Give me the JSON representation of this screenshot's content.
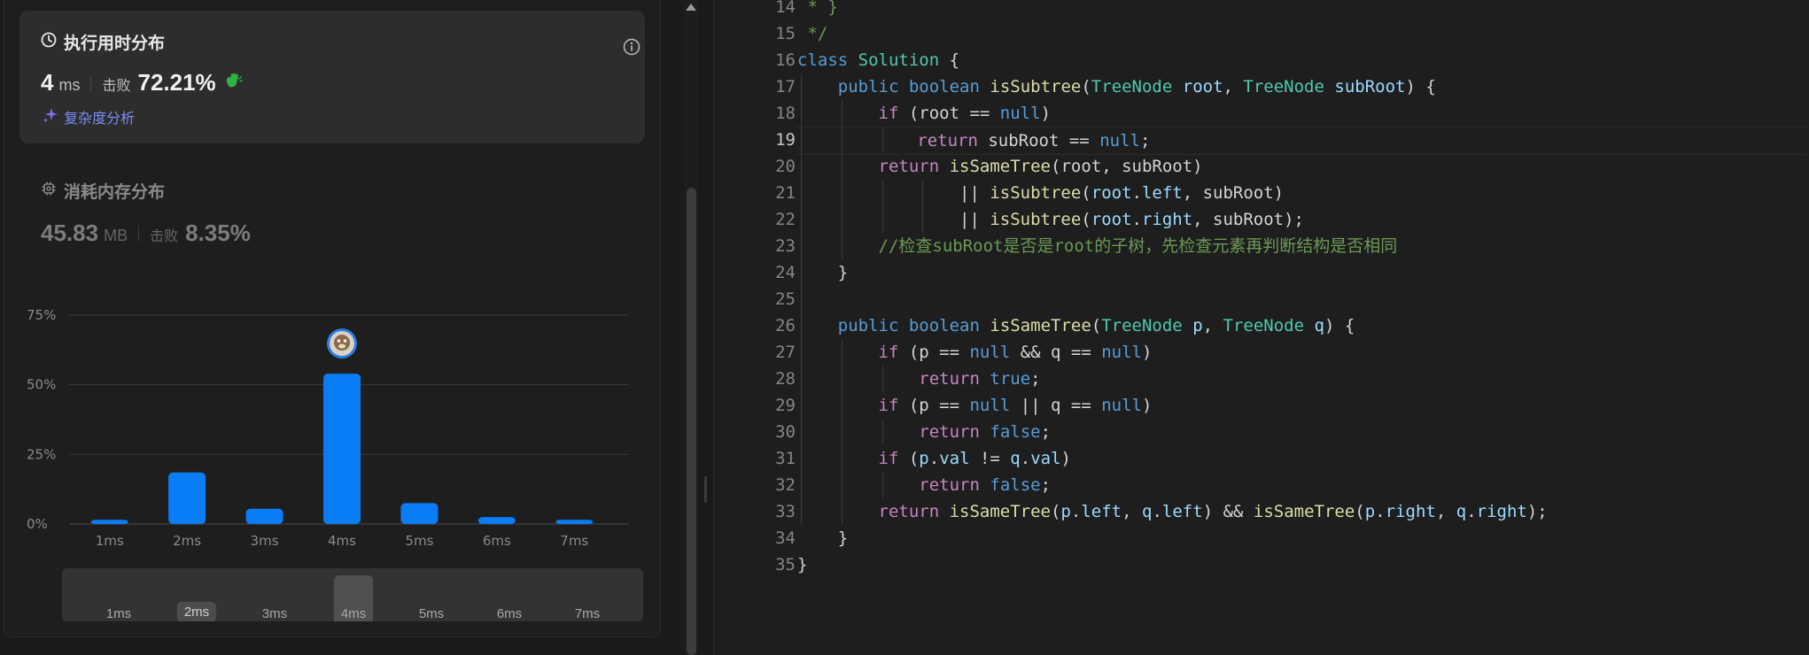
{
  "runtime": {
    "title": "执行用时分布",
    "value": "4",
    "unit": "ms",
    "beat_label": "击败",
    "beat_percent": "72.21%",
    "complexity_link": "复杂度分析"
  },
  "memory": {
    "title": "消耗内存分布",
    "value": "45.83",
    "unit": "MB",
    "beat_label": "击败",
    "beat_percent": "8.35%"
  },
  "chart_data": {
    "type": "bar",
    "categories": [
      "1ms",
      "2ms",
      "3ms",
      "4ms",
      "5ms",
      "6ms",
      "7ms"
    ],
    "values": [
      1.5,
      18.5,
      5.5,
      54,
      7.5,
      2.5,
      1.5
    ],
    "ylim": [
      0,
      75
    ],
    "yticks": [
      "0%",
      "25%",
      "50%",
      "75%"
    ],
    "ytick_values": [
      0,
      25,
      50,
      75
    ],
    "highlight_category": "4ms",
    "bar_color": "#0a7cf5",
    "grid": true
  },
  "range_slider": {
    "labels": [
      "1ms",
      "2ms",
      "3ms",
      "4ms",
      "5ms",
      "6ms",
      "7ms"
    ],
    "selected_pill": "2ms",
    "highlighted": "4ms"
  },
  "editor": {
    "line_numbers": [
      "14",
      "15",
      "16",
      "17",
      "18",
      "19",
      "20",
      "21",
      "22",
      "23",
      "24",
      "25",
      "26",
      "27",
      "28",
      "29",
      "30",
      "31",
      "32",
      "33",
      "34",
      "35"
    ],
    "active_line": "19",
    "lines": [
      [
        [
          "cm",
          " * }"
        ]
      ],
      [
        [
          "cm",
          " */"
        ]
      ],
      [
        [
          "kw",
          "class"
        ],
        [
          "pun",
          " "
        ],
        [
          "ty",
          "Solution"
        ],
        [
          "pun",
          " {"
        ]
      ],
      [
        [
          "pun",
          "    "
        ],
        [
          "kw",
          "public"
        ],
        [
          "pun",
          " "
        ],
        [
          "kw",
          "boolean"
        ],
        [
          "pun",
          " "
        ],
        [
          "fn",
          "isSubtree"
        ],
        [
          "pun",
          "("
        ],
        [
          "ty",
          "TreeNode"
        ],
        [
          "pun",
          " "
        ],
        [
          "var",
          "root"
        ],
        [
          "pun",
          ", "
        ],
        [
          "ty",
          "TreeNode"
        ],
        [
          "pun",
          " "
        ],
        [
          "var",
          "subRoot"
        ],
        [
          "pun",
          ") {"
        ]
      ],
      [
        [
          "pun",
          "        "
        ],
        [
          "ctl",
          "if"
        ],
        [
          "pun",
          " (root == "
        ],
        [
          "kw",
          "null"
        ],
        [
          "pun",
          ")"
        ]
      ],
      [
        [
          "pun",
          "            "
        ],
        [
          "ctl",
          "return"
        ],
        [
          "pun",
          " subRoot == "
        ],
        [
          "kw",
          "null"
        ],
        [
          "pun",
          ";"
        ]
      ],
      [
        [
          "pun",
          "        "
        ],
        [
          "ctl",
          "return"
        ],
        [
          "pun",
          " "
        ],
        [
          "fn",
          "isSameTree"
        ],
        [
          "pun",
          "(root, subRoot)"
        ]
      ],
      [
        [
          "pun",
          "                || "
        ],
        [
          "fn",
          "isSubtree"
        ],
        [
          "pun",
          "("
        ],
        [
          "var",
          "root"
        ],
        [
          "pun",
          "."
        ],
        [
          "var",
          "left"
        ],
        [
          "pun",
          ", subRoot)"
        ]
      ],
      [
        [
          "pun",
          "                || "
        ],
        [
          "fn",
          "isSubtree"
        ],
        [
          "pun",
          "("
        ],
        [
          "var",
          "root"
        ],
        [
          "pun",
          "."
        ],
        [
          "var",
          "right"
        ],
        [
          "pun",
          ", subRoot);"
        ]
      ],
      [
        [
          "pun",
          "        "
        ],
        [
          "cm",
          "//检查subRoot是否是root的子树，先检查元素再判断结构是否相同"
        ]
      ],
      [
        [
          "pun",
          "    }"
        ]
      ],
      [
        [
          "pun",
          ""
        ]
      ],
      [
        [
          "pun",
          "    "
        ],
        [
          "kw",
          "public"
        ],
        [
          "pun",
          " "
        ],
        [
          "kw",
          "boolean"
        ],
        [
          "pun",
          " "
        ],
        [
          "fn",
          "isSameTree"
        ],
        [
          "pun",
          "("
        ],
        [
          "ty",
          "TreeNode"
        ],
        [
          "pun",
          " "
        ],
        [
          "var",
          "p"
        ],
        [
          "pun",
          ", "
        ],
        [
          "ty",
          "TreeNode"
        ],
        [
          "pun",
          " "
        ],
        [
          "var",
          "q"
        ],
        [
          "pun",
          ") {"
        ]
      ],
      [
        [
          "pun",
          "        "
        ],
        [
          "ctl",
          "if"
        ],
        [
          "pun",
          " (p == "
        ],
        [
          "kw",
          "null"
        ],
        [
          "pun",
          " && q == "
        ],
        [
          "kw",
          "null"
        ],
        [
          "pun",
          ")"
        ]
      ],
      [
        [
          "pun",
          "            "
        ],
        [
          "ctl",
          "return"
        ],
        [
          "pun",
          " "
        ],
        [
          "kw",
          "true"
        ],
        [
          "pun",
          ";"
        ]
      ],
      [
        [
          "pun",
          "        "
        ],
        [
          "ctl",
          "if"
        ],
        [
          "pun",
          " (p == "
        ],
        [
          "kw",
          "null"
        ],
        [
          "pun",
          " || q == "
        ],
        [
          "kw",
          "null"
        ],
        [
          "pun",
          ")"
        ]
      ],
      [
        [
          "pun",
          "            "
        ],
        [
          "ctl",
          "return"
        ],
        [
          "pun",
          " "
        ],
        [
          "kw",
          "false"
        ],
        [
          "pun",
          ";"
        ]
      ],
      [
        [
          "pun",
          "        "
        ],
        [
          "ctl",
          "if"
        ],
        [
          "pun",
          " ("
        ],
        [
          "var",
          "p"
        ],
        [
          "pun",
          "."
        ],
        [
          "var",
          "val"
        ],
        [
          "pun",
          " != "
        ],
        [
          "var",
          "q"
        ],
        [
          "pun",
          "."
        ],
        [
          "var",
          "val"
        ],
        [
          "pun",
          ")"
        ]
      ],
      [
        [
          "pun",
          "            "
        ],
        [
          "ctl",
          "return"
        ],
        [
          "pun",
          " "
        ],
        [
          "kw",
          "false"
        ],
        [
          "pun",
          ";"
        ]
      ],
      [
        [
          "pun",
          "        "
        ],
        [
          "ctl",
          "return"
        ],
        [
          "pun",
          " "
        ],
        [
          "fn",
          "isSameTree"
        ],
        [
          "pun",
          "("
        ],
        [
          "var",
          "p"
        ],
        [
          "pun",
          "."
        ],
        [
          "var",
          "left"
        ],
        [
          "pun",
          ", "
        ],
        [
          "var",
          "q"
        ],
        [
          "pun",
          "."
        ],
        [
          "var",
          "left"
        ],
        [
          "pun",
          ") && "
        ],
        [
          "fn",
          "isSameTree"
        ],
        [
          "pun",
          "("
        ],
        [
          "var",
          "p"
        ],
        [
          "pun",
          "."
        ],
        [
          "var",
          "right"
        ],
        [
          "pun",
          ", "
        ],
        [
          "var",
          "q"
        ],
        [
          "pun",
          "."
        ],
        [
          "var",
          "right"
        ],
        [
          "pun",
          ");"
        ]
      ],
      [
        [
          "pun",
          "    }"
        ]
      ],
      [
        [
          "pun",
          "}"
        ]
      ]
    ]
  }
}
